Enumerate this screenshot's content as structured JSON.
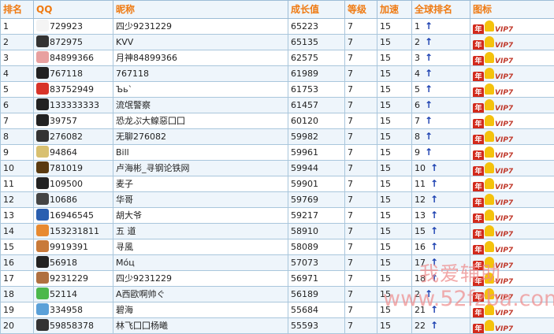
{
  "headers": {
    "rank": "排名",
    "qq": "QQ",
    "nickname": "昵称",
    "growth": "成长值",
    "level": "等级",
    "speed": "加速",
    "global_rank": "全球排名",
    "icon": "图标"
  },
  "rows": [
    {
      "rank": "1",
      "qq": "729923",
      "nickname": "四少9231229",
      "growth": "65223",
      "level": "7",
      "speed": "15",
      "global_rank": "1",
      "avatar_color": "#f4f4f4"
    },
    {
      "rank": "2",
      "qq": "872975",
      "nickname": "KVV",
      "growth": "65135",
      "level": "7",
      "speed": "15",
      "global_rank": "2",
      "avatar_color": "#333333"
    },
    {
      "rank": "3",
      "qq": "84899366",
      "nickname": "月神84899366",
      "growth": "62575",
      "level": "7",
      "speed": "15",
      "global_rank": "3",
      "avatar_color": "#e8a0a0"
    },
    {
      "rank": "4",
      "qq": "767118",
      "nickname": "767118",
      "growth": "61989",
      "level": "7",
      "speed": "15",
      "global_rank": "4",
      "avatar_color": "#222222"
    },
    {
      "rank": "5",
      "qq": "83752949",
      "nickname": "Ъь`",
      "growth": "61753",
      "level": "7",
      "speed": "15",
      "global_rank": "5",
      "avatar_color": "#d8342a"
    },
    {
      "rank": "6",
      "qq": "133333333",
      "nickname": "流氓警察",
      "growth": "61457",
      "level": "7",
      "speed": "15",
      "global_rank": "6",
      "avatar_color": "#222222"
    },
    {
      "rank": "7",
      "qq": "39757",
      "nickname": "恐龙ぷ大鳈惡囗囗",
      "growth": "60120",
      "level": "7",
      "speed": "15",
      "global_rank": "7",
      "avatar_color": "#222222"
    },
    {
      "rank": "8",
      "qq": "276082",
      "nickname": "无聊276082",
      "growth": "59982",
      "level": "7",
      "speed": "15",
      "global_rank": "8",
      "avatar_color": "#333333"
    },
    {
      "rank": "9",
      "qq": "94864",
      "nickname": "Bill",
      "growth": "59961",
      "level": "7",
      "speed": "15",
      "global_rank": "9",
      "avatar_color": "#d8c070"
    },
    {
      "rank": "10",
      "qq": "781019",
      "nickname": "卢海彬_寻钢论铁网",
      "growth": "59944",
      "level": "7",
      "speed": "15",
      "global_rank": "10",
      "avatar_color": "#5a3a10"
    },
    {
      "rank": "11",
      "qq": "109500",
      "nickname": "麦子",
      "growth": "59901",
      "level": "7",
      "speed": "15",
      "global_rank": "11",
      "avatar_color": "#222222"
    },
    {
      "rank": "12",
      "qq": "10686",
      "nickname": "华哥",
      "growth": "59769",
      "level": "7",
      "speed": "15",
      "global_rank": "12",
      "avatar_color": "#444444"
    },
    {
      "rank": "13",
      "qq": "16946545",
      "nickname": "胡大爷",
      "growth": "59217",
      "level": "7",
      "speed": "15",
      "global_rank": "13",
      "avatar_color": "#2a5fb0"
    },
    {
      "rank": "14",
      "qq": "153231811",
      "nickname": "五 道",
      "growth": "58910",
      "level": "7",
      "speed": "15",
      "global_rank": "15",
      "avatar_color": "#e88a30"
    },
    {
      "rank": "15",
      "qq": "9919391",
      "nickname": "寻風",
      "growth": "58089",
      "level": "7",
      "speed": "15",
      "global_rank": "16",
      "avatar_color": "#c87a3a"
    },
    {
      "rank": "16",
      "qq": "56918",
      "nickname": "Mόц",
      "growth": "57073",
      "level": "7",
      "speed": "15",
      "global_rank": "17",
      "avatar_color": "#222222"
    },
    {
      "rank": "17",
      "qq": "9231229",
      "nickname": "四少9231229",
      "growth": "56971",
      "level": "7",
      "speed": "15",
      "global_rank": "18",
      "avatar_color": "#b07040"
    },
    {
      "rank": "18",
      "qq": "52114",
      "nickname": "A西歐啊帅ぐ",
      "growth": "56189",
      "level": "7",
      "speed": "15",
      "global_rank": "2",
      "avatar_color": "#4cb84c"
    },
    {
      "rank": "19",
      "qq": "334958",
      "nickname": "碧海",
      "growth": "55684",
      "level": "7",
      "speed": "15",
      "global_rank": "21",
      "avatar_color": "#5aa0d8"
    },
    {
      "rank": "20",
      "qq": "59858378",
      "nickname": "林飞囗囗杨曦",
      "growth": "55593",
      "level": "7",
      "speed": "15",
      "global_rank": "22",
      "avatar_color": "#333333"
    }
  ],
  "icon_badge": {
    "nian": "年",
    "vip": "VIP7"
  },
  "watermark": {
    "line1": "我爱辅助",
    "line2": "www.52fzba.com"
  },
  "colors": {
    "header_text": "#ef7a12",
    "border": "#a9c6dc",
    "row_alt": "#eef5fb",
    "arrow": "#1a3fb0"
  }
}
